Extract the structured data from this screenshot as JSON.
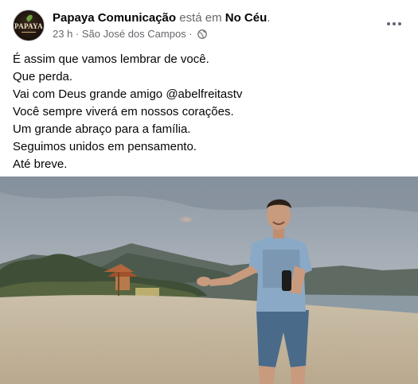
{
  "post": {
    "page_name": "Papaya Comunicação",
    "verb": " está em ",
    "place": "No Céu",
    "place_suffix": ".",
    "time": "23 h",
    "separator": " · ",
    "location": "São José dos Campos",
    "separator2": " · ",
    "privacy_icon": "globe-icon",
    "avatar_text": "PAPAYA",
    "lines": [
      "É assim que vamos lembrar de você.",
      "Que perda.",
      "Vai com Deus grande amigo @abelfreitastv",
      "Você sempre viverá em nossos corações.",
      "Um grande abraço para a família.",
      "Seguimos unidos em pensamento.",
      "Até breve."
    ]
  },
  "colors": {
    "secondary_text": "#65676b",
    "primary_text": "#050505"
  }
}
